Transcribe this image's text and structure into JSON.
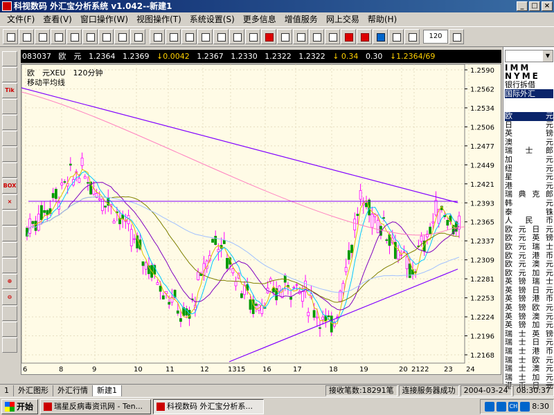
{
  "window": {
    "title": "科视数码 外汇宝分析系统 v1.042--新建1",
    "buttons": [
      "_",
      "□",
      "×"
    ]
  },
  "menu": [
    "文件(F)",
    "查看(V)",
    "窗口操作(W)",
    "视图操作(T)",
    "系统设置(S)",
    "更多信息",
    "增值服务",
    "网上交易",
    "帮助(H)"
  ],
  "toolbar": {
    "zoom": "120"
  },
  "left_tools": [
    "",
    "",
    "Tik",
    "",
    "",
    "",
    "",
    "",
    "BOX",
    "×",
    "",
    "",
    "",
    "",
    "⊕",
    "⊖",
    "",
    "",
    ""
  ],
  "quote": {
    "code": "083037",
    "name": "欧　元",
    "open": "1.2364",
    "prev": "1.2369",
    "change": "↓0.0042",
    "v1": "1.2367",
    "v2": "1.2330",
    "v3": "1.2322",
    "v4": "1.2322",
    "v5": "↓ 0.34",
    "v6": "0.30",
    "v7": "↓1.2364/69"
  },
  "chart_header": {
    "line1": "欧　元XEU　120分钟",
    "line2": "移动平均线"
  },
  "chart_data": {
    "type": "candlestick",
    "y_ticks": [
      "1.2590",
      "1.2562",
      "1.2534",
      "1.2506",
      "1.2477",
      "1.2449",
      "1.2421",
      "1.2393",
      "1.2365",
      "1.2337",
      "1.2309",
      "1.2281",
      "1.2253",
      "1.2224",
      "1.2196",
      "1.2168"
    ],
    "x_ticks": [
      "6",
      "8",
      "9",
      "10",
      "11",
      "12",
      "1315",
      "16",
      "17",
      "18",
      "19",
      "20",
      "2122",
      "23",
      "24"
    ],
    "ylim": [
      1.214,
      1.26
    ]
  },
  "right_panel": {
    "imm": "IMM NYME",
    "tab1": "银行拆借",
    "tab2": "国际外汇",
    "list": [
      "欧　　元",
      "日　　元",
      "英　　镑",
      "澳　　元",
      "瑞　士　郎",
      "加　　元",
      "纽　　元",
      "星　　元",
      "港　　元",
      "瑞典克郎",
      "韩　　元",
      "泰　　铢",
      "人民币",
      "欧元日元",
      "欧元英镑",
      "欧元瑞士",
      "欧元港币",
      "欧元澳元",
      "欧元加元",
      "英镑瑞士",
      "英镑日元",
      "英镑港币",
      "英镑欧元",
      "英镑澳元",
      "英镑加元",
      "瑞士英镑",
      "瑞士日元",
      "瑞士港币",
      "瑞士欧元",
      "瑞士澳元",
      "瑞士加元",
      "港币日元"
    ]
  },
  "bottom_tabs": [
    "1",
    "外汇图形",
    "外汇行情",
    "新建1"
  ],
  "status": {
    "count": "接收笔数:18291笔",
    "conn": "连接服务器成功",
    "date": "2004-03-24",
    "time": "08:30:37"
  },
  "taskbar": {
    "start": "开始",
    "tasks": [
      "瑞星反病毒资讯网 - Ten...",
      "科视数码 外汇宝分析系..."
    ],
    "clock": "8:30",
    "tray": [
      "CH"
    ]
  }
}
